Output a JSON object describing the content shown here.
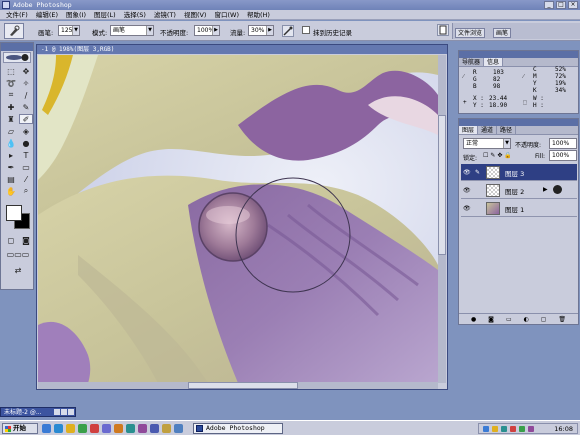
{
  "titlebar": {
    "title": "Adobe Photoshop"
  },
  "menu": [
    {
      "label": "文件(F)"
    },
    {
      "label": "编辑(E)"
    },
    {
      "label": "图象(I)"
    },
    {
      "label": "图层(L)"
    },
    {
      "label": "选择(S)"
    },
    {
      "label": "滤镜(T)"
    },
    {
      "label": "视图(V)"
    },
    {
      "label": "窗口(W)"
    },
    {
      "label": "帮助(H)"
    }
  ],
  "options": {
    "brush_label": "画笔:",
    "brush_size": "125",
    "mode_label": "模式:",
    "mode_value": "画笔",
    "opacity_label": "不透明度:",
    "opacity_value": "100%",
    "flow_label": "流量:",
    "flow_value": "30%",
    "history_label": "抹到历史记录",
    "well_tabs": [
      "文件浏览",
      "画笔"
    ]
  },
  "document": {
    "title": "-1 @ 198%(图层 3,RGB)",
    "tab_title": "未标题-2 @..."
  },
  "nav_panel": {
    "tabs": [
      "导航器",
      "信息"
    ],
    "rgb": [
      {
        "k": "R",
        "v": "103"
      },
      {
        "k": "G",
        "v": "82"
      },
      {
        "k": "B",
        "v": "98"
      }
    ],
    "cmyk": [
      {
        "k": "C",
        "v": "52%"
      },
      {
        "k": "M",
        "v": "72%"
      },
      {
        "k": "Y",
        "v": "19%"
      },
      {
        "k": "K",
        "v": "34%"
      }
    ],
    "x_label": "X :",
    "x_value": "23.44",
    "y_label": "Y :",
    "y_value": "18.90",
    "w_label": "W :",
    "h_label": "H :"
  },
  "layers_panel": {
    "tabs": [
      "图层",
      "通道",
      "路径"
    ],
    "mode": "正常",
    "opacity_label": "不透明度:",
    "opacity_value": "100%",
    "lock_label": "锁定:",
    "fill_label": "Fill:",
    "fill_value": "100%",
    "layers": [
      {
        "name": "图层 3",
        "active": true
      },
      {
        "name": "图层 2",
        "active": false
      },
      {
        "name": "图层 1",
        "active": false
      }
    ]
  },
  "taskbar": {
    "start_label": "开始",
    "app_label": "Adobe Photoshop",
    "clock": "16:08"
  }
}
